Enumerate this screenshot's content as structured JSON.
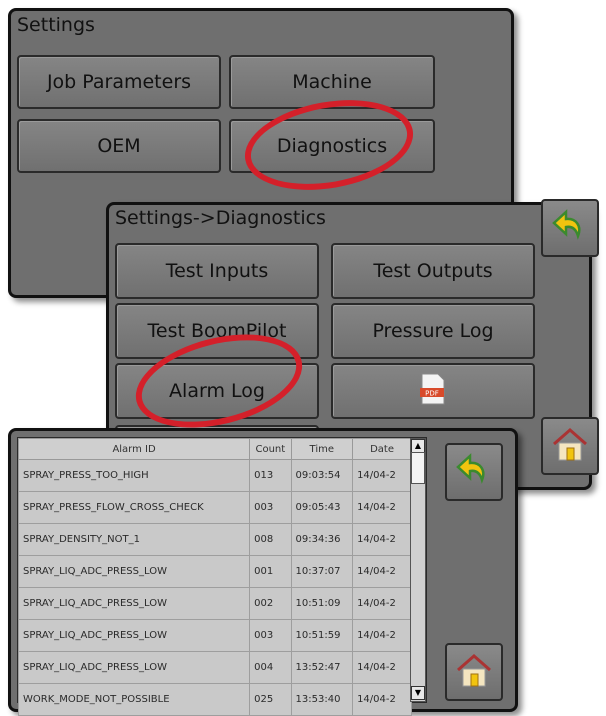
{
  "settings": {
    "title": "Settings",
    "buttons": [
      "Job Parameters",
      "Machine",
      "OEM",
      "Diagnostics"
    ]
  },
  "diagnostics": {
    "title": "Settings->Diagnostics",
    "buttons": [
      "Test Inputs",
      "Test Outputs",
      "Test BoomPilot",
      "Pressure Log",
      "Alarm Log"
    ],
    "pdf_icon": "pdf-icon",
    "back_icon": "back-arrow-icon",
    "home_icon": "home-icon"
  },
  "alarm_log": {
    "columns": [
      "Alarm ID",
      "Count",
      "Time",
      "Date"
    ],
    "rows": [
      [
        "SPRAY_PRESS_TOO_HIGH",
        "013",
        "09:03:54",
        "14/04-2"
      ],
      [
        "SPRAY_PRESS_FLOW_CROSS_CHECK",
        "003",
        "09:05:43",
        "14/04-2"
      ],
      [
        "SPRAY_DENSITY_NOT_1",
        "008",
        "09:34:36",
        "14/04-2"
      ],
      [
        "SPRAY_LIQ_ADC_PRESS_LOW",
        "001",
        "10:37:07",
        "14/04-2"
      ],
      [
        "SPRAY_LIQ_ADC_PRESS_LOW",
        "002",
        "10:51:09",
        "14/04-2"
      ],
      [
        "SPRAY_LIQ_ADC_PRESS_LOW",
        "003",
        "10:51:59",
        "14/04-2"
      ],
      [
        "SPRAY_LIQ_ADC_PRESS_LOW",
        "004",
        "13:52:47",
        "14/04-2"
      ],
      [
        "WORK_MODE_NOT_POSSIBLE",
        "025",
        "13:53:40",
        "14/04-2"
      ]
    ],
    "back_icon": "back-arrow-icon",
    "home_icon": "home-icon"
  },
  "colors": {
    "highlight": "#d4202a",
    "panel": "#6f6f6f",
    "back_arrow": "#f1c40f"
  }
}
